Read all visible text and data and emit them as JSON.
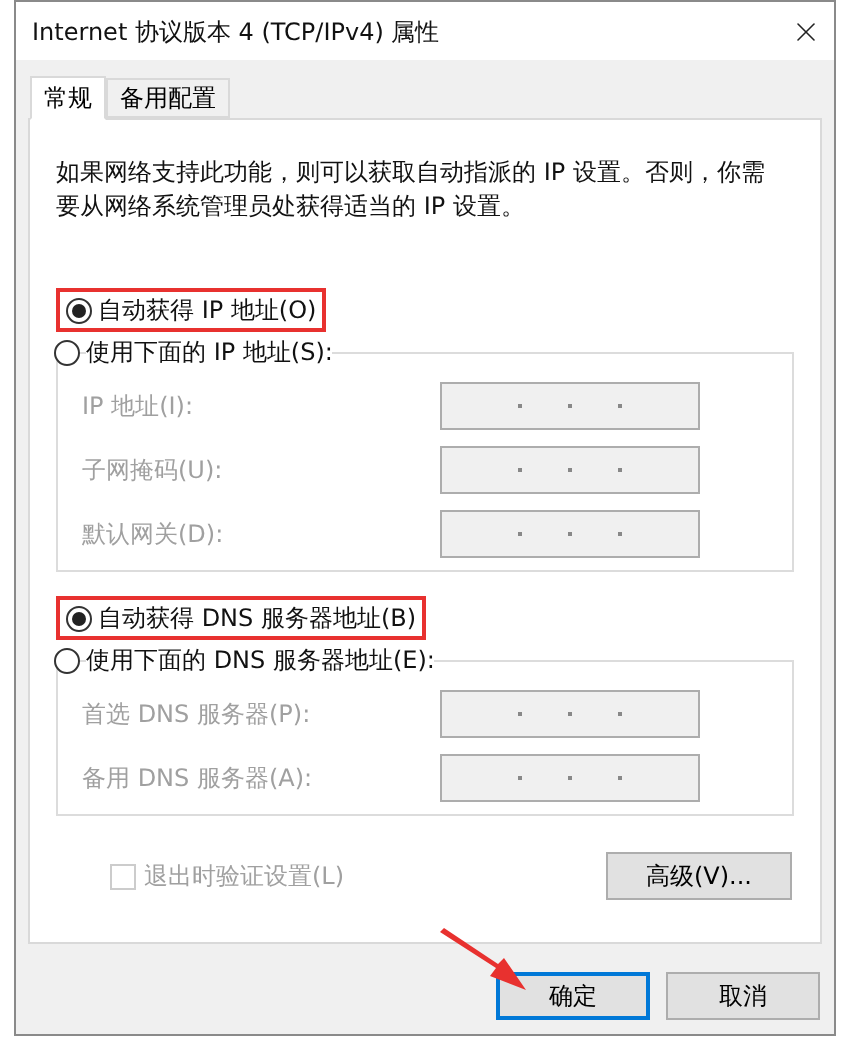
{
  "window": {
    "title": "Internet 协议版本 4 (TCP/IPv4) 属性"
  },
  "tabs": [
    {
      "label": "常规",
      "selected": true
    },
    {
      "label": "备用配置",
      "selected": false
    }
  ],
  "description": "如果网络支持此功能，则可以获取自动指派的 IP 设置。否则，你需要从网络系统管理员处获得适当的 IP 设置。",
  "sections": [
    {
      "auto_option": {
        "label": "自动获得 IP 地址(O)",
        "selected": true,
        "highlighted": true
      },
      "manual_option": {
        "label": "使用下面的 IP 地址(S):",
        "selected": false,
        "highlighted": false
      },
      "fields": [
        {
          "label": "IP 地址(I):",
          "disabled": true
        },
        {
          "label": "子网掩码(U):",
          "disabled": true
        },
        {
          "label": "默认网关(D):",
          "disabled": true
        }
      ]
    },
    {
      "auto_option": {
        "label": "自动获得 DNS 服务器地址(B)",
        "selected": true,
        "highlighted": true
      },
      "manual_option": {
        "label": "使用下面的 DNS 服务器地址(E):",
        "selected": false,
        "highlighted": false
      },
      "fields": [
        {
          "label": "首选 DNS 服务器(P):",
          "disabled": true
        },
        {
          "label": "备用 DNS 服务器(A):",
          "disabled": true
        }
      ]
    }
  ],
  "checkbox": {
    "label": "退出时验证设置(L)",
    "checked": false,
    "disabled": true
  },
  "advanced_button": "高级(V)...",
  "buttons": [
    {
      "label": "确定",
      "default": true,
      "pointed": true
    },
    {
      "label": "取消",
      "default": false,
      "pointed": false
    }
  ]
}
